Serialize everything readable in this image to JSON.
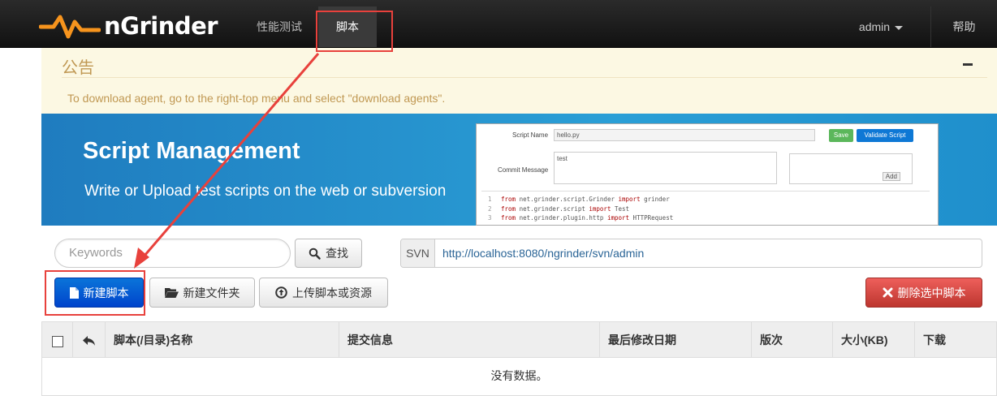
{
  "navbar": {
    "logo_text": "nGrinder",
    "nav_performance": "性能测试",
    "nav_script": "脚本",
    "user": "admin",
    "help": "帮助"
  },
  "notice": {
    "title": "公告",
    "text": "To download agent, go to the right-top menu and select \"download agents\"."
  },
  "banner": {
    "title": "Script Management",
    "subtitle": "Write or Upload test scripts on the web or subversion",
    "screenshot": {
      "script_name_label": "Script Name",
      "script_name_value": "hello.py",
      "save_label": "Save",
      "validate_label": "Validate Script",
      "commit_message_label": "Commit Message",
      "commit_message_value": "test",
      "add_label": "Add",
      "code_lines": [
        {
          "num": "1",
          "kw1": "from",
          "mod": " net.grinder.script.Grinder ",
          "kw2": "import",
          "name": " grinder"
        },
        {
          "num": "2",
          "kw1": "from",
          "mod": " net.grinder.script ",
          "kw2": "import",
          "name": " Test"
        },
        {
          "num": "3",
          "kw1": "from",
          "mod": " net.grinder.plugin.http ",
          "kw2": "import",
          "name": " HTTPRequest"
        }
      ]
    }
  },
  "toolbar": {
    "search_placeholder": "Keywords",
    "search_button": "查找",
    "svn_label": "SVN",
    "svn_url": "http://localhost:8080/ngrinder/svn/admin",
    "new_script": "新建脚本",
    "new_folder": "新建文件夹",
    "upload": "上传脚本或资源",
    "delete_selected": "删除选中脚本"
  },
  "table": {
    "columns": [
      "脚本(/目录)名称",
      "提交信息",
      "最后修改日期",
      "版次",
      "大小(KB)",
      "下载"
    ],
    "empty_text": "没有数据。"
  },
  "colors": {
    "annotation_red": "#e8413c",
    "primary": "#0044cc",
    "danger": "#bd362f",
    "banner_blue": "#2a9fd6"
  }
}
